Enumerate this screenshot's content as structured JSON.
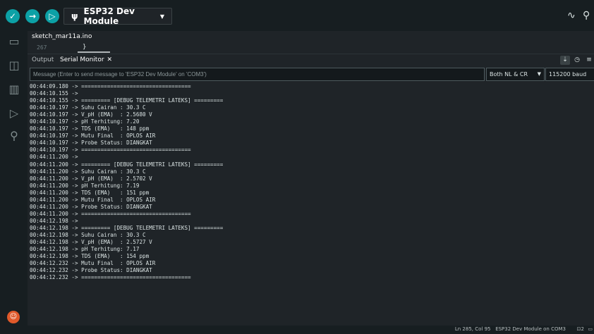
{
  "toolbar": {
    "board_label": "ESP32 Dev Module",
    "verify_icon": "check-icon",
    "upload_icon": "arrow-right-icon",
    "debug_icon": "debug-icon"
  },
  "editor": {
    "file_tab": "sketch_mar11a.ino",
    "line_number": "267",
    "code": "}"
  },
  "panel": {
    "tabs": [
      {
        "label": "Output"
      },
      {
        "label": "Serial Monitor"
      }
    ],
    "close_glyph": "✕"
  },
  "serial": {
    "message_placeholder": "Message (Enter to send message to 'ESP32 Dev Module' on 'COM3')",
    "line_ending": "Both NL & CR",
    "baud": "115200 baud",
    "lines": [
      "00:44:09.180 -> ==================================",
      "00:44:10.155 ->",
      "00:44:10.155 -> ========= [DEBUG TELEMETRI LATEKS] =========",
      "00:44:10.197 -> Suhu Cairan : 30.3 C",
      "00:44:10.197 -> V_pH (EMA)  : 2.5680 V",
      "00:44:10.197 -> pH Terhitung: 7.20",
      "00:44:10.197 -> TDS (EMA)   : 148 ppm",
      "00:44:10.197 -> Mutu Final  : OPLOS AIR",
      "00:44:10.197 -> Probe Status: DIANGKAT",
      "00:44:10.197 -> ==================================",
      "00:44:11.200 ->",
      "00:44:11.200 -> ========= [DEBUG TELEMETRI LATEKS] =========",
      "00:44:11.200 -> Suhu Cairan : 30.3 C",
      "00:44:11.200 -> V_pH (EMA)  : 2.5702 V",
      "00:44:11.200 -> pH Terhitung: 7.19",
      "00:44:11.200 -> TDS (EMA)   : 151 ppm",
      "00:44:11.200 -> Mutu Final  : OPLOS AIR",
      "00:44:11.200 -> Probe Status: DIANGKAT",
      "00:44:11.200 -> ==================================",
      "00:44:12.198 ->",
      "00:44:12.198 -> ========= [DEBUG TELEMETRI LATEKS] =========",
      "00:44:12.198 -> Suhu Cairan : 30.3 C",
      "00:44:12.198 -> V_pH (EMA)  : 2.5727 V",
      "00:44:12.198 -> pH Terhitung: 7.17",
      "00:44:12.198 -> TDS (EMA)   : 154 ppm",
      "00:44:12.232 -> Mutu Final  : OPLOS AIR",
      "00:44:12.232 -> Probe Status: DIANGKAT",
      "00:44:12.232 -> =================================="
    ]
  },
  "status": {
    "position": "Ln 285, Col 95",
    "board_port": "ESP32 Dev Module on COM3",
    "notifications": "2"
  },
  "colors": {
    "accent": "#0ca1a6",
    "background": "#1f2428",
    "sidebar": "#171e21"
  }
}
